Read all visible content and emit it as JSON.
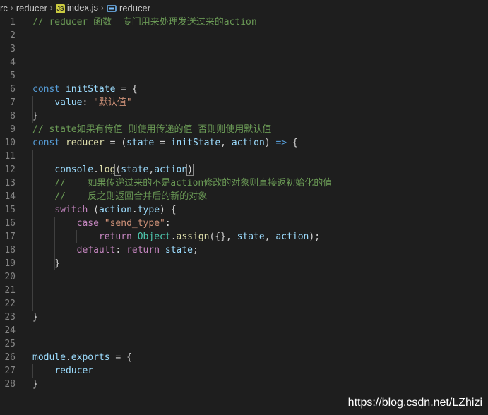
{
  "breadcrumb": {
    "part1": "rc",
    "part2": "reducer",
    "part3": "index.js",
    "part4": "reducer",
    "js_badge": "JS"
  },
  "lines": {
    "n1": "1",
    "n2": "2",
    "n3": "3",
    "n4": "4",
    "n5": "5",
    "n6": "6",
    "n7": "7",
    "n8": "8",
    "n9": "9",
    "n10": "10",
    "n11": "11",
    "n12": "12",
    "n13": "13",
    "n14": "14",
    "n15": "15",
    "n16": "16",
    "n17": "17",
    "n18": "18",
    "n19": "19",
    "n20": "20",
    "n21": "21",
    "n22": "22",
    "n23": "23",
    "n24": "24",
    "n25": "25",
    "n26": "26",
    "n27": "27",
    "n28": "28"
  },
  "code": {
    "l1_comment": "// reducer 函数  专门用来处理发送过来的action",
    "l6_const": "const",
    "l6_name": "initState",
    "l6_rest": " = {",
    "l7_key": "value",
    "l7_colon": ": ",
    "l7_value": "\"默认值\"",
    "l8": "}",
    "l9_comment": "// state如果有传值 则使用传递的值 否则则使用默认值",
    "l10_const": "const",
    "l10_name": "reducer",
    "l10_eq": " = (",
    "l10_p1": "state",
    "l10_eq2": " = ",
    "l10_p2": "initState",
    "l10_comma": ", ",
    "l10_p3": "action",
    "l10_close": ") ",
    "l10_arrow": "=>",
    "l10_brace": " {",
    "l12_console": "console",
    "l12_dot": ".",
    "l12_log": "log",
    "l12_open": "(",
    "l12_a1": "state",
    "l12_comma": ",",
    "l12_a2": "action",
    "l12_close": ")",
    "l13_comment": "//    如果传递过来的不是action修改的对象则直接返初始化的值",
    "l14_comment": "//    反之则返回合并后的新的对象",
    "l15_switch": "switch",
    "l15_open": " (",
    "l15_obj": "action",
    "l15_dot": ".",
    "l15_prop": "type",
    "l15_close": ") {",
    "l16_case": "case",
    "l16_space": " ",
    "l16_str": "\"send_type\"",
    "l16_colon": ":",
    "l17_return": "return",
    "l17_space": " ",
    "l17_obj": "Object",
    "l17_dot": ".",
    "l17_fn": "assign",
    "l17_args1": "({}, ",
    "l17_state": "state",
    "l17_comma": ", ",
    "l17_action": "action",
    "l17_end": ");",
    "l18_default": "default",
    "l18_colon": ": ",
    "l18_return": "return",
    "l18_space": " ",
    "l18_state": "state",
    "l18_semi": ";",
    "l19": "}",
    "l23": "}",
    "l26_module": "module",
    "l26_dot": ".",
    "l26_exports": "exports",
    "l26_rest": " = {",
    "l27": "reducer",
    "l28": "}"
  },
  "watermark": "https://blog.csdn.net/LZhizi"
}
